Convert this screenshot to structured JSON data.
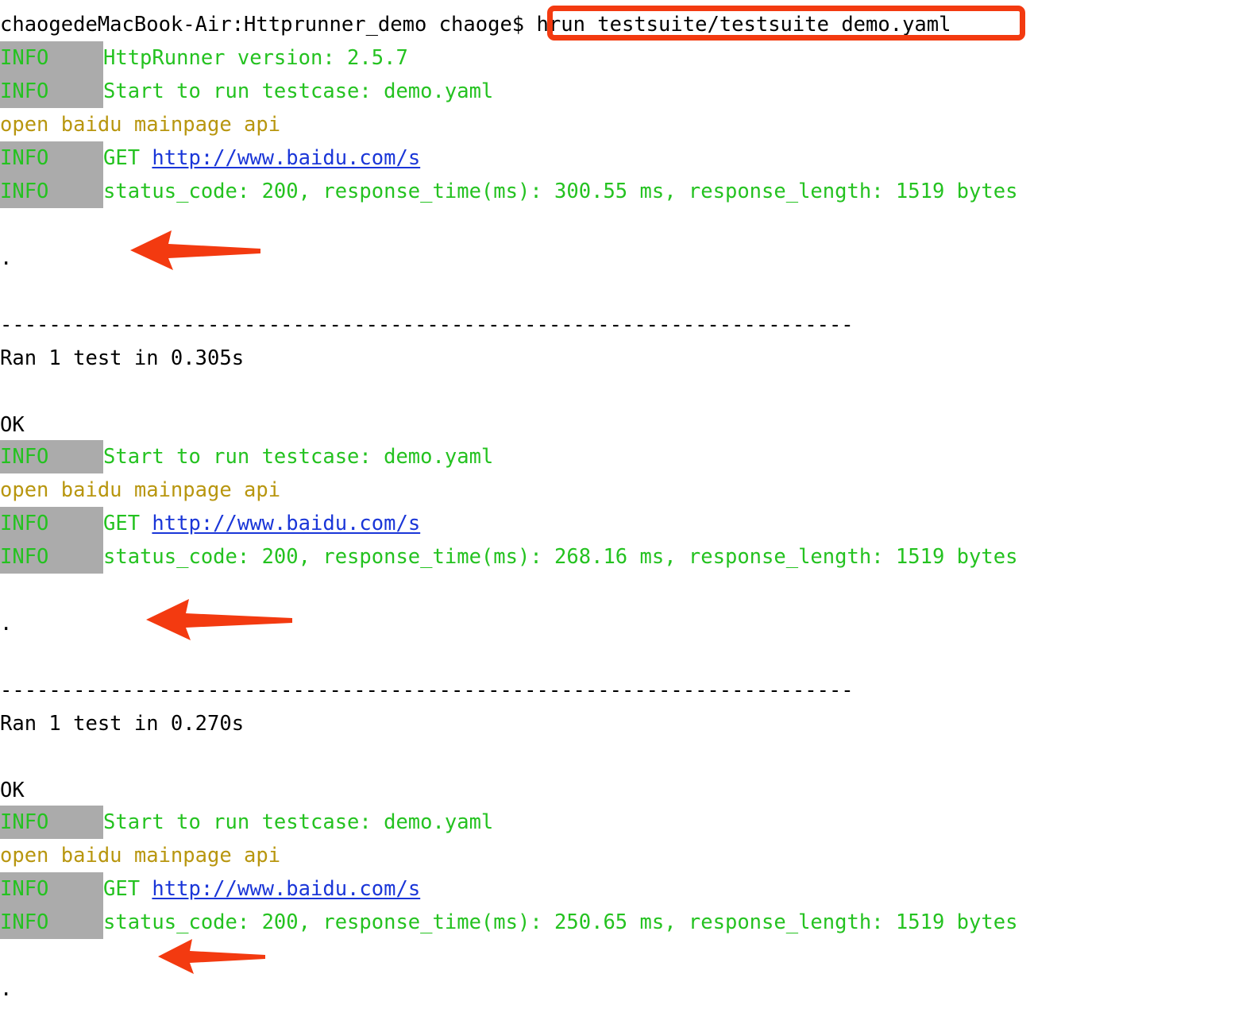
{
  "terminal": {
    "prompt": {
      "host_user": "chaogedeMacBook-Air:Httprunner_demo chaoge$",
      "command": "hrun testsuite/testsuite_demo.yaml"
    },
    "labels": {
      "info": "INFO",
      "ok": "OK",
      "dot": ".",
      "separator": "----------------------------------------------------------------------"
    },
    "blocks": [
      {
        "version_line": "HttpRunner version: 2.5.7",
        "start_line": "Start to run testcase: demo.yaml",
        "api_name": "open baidu mainpage api",
        "method": "GET ",
        "url": "http://www.baidu.com/s",
        "status_line": "status_code: 200, response_time(ms): 300.55 ms, response_length: 1519 bytes",
        "ran_line": "Ran 1 test in 0.305s",
        "result": "OK"
      },
      {
        "start_line": "Start to run testcase: demo.yaml",
        "api_name": "open baidu mainpage api",
        "method": "GET ",
        "url": "http://www.baidu.com/s",
        "status_line": "status_code: 200, response_time(ms): 268.16 ms, response_length: 1519 bytes",
        "ran_line": "Ran 1 test in 0.270s",
        "result": "OK"
      },
      {
        "start_line": "Start to run testcase: demo.yaml",
        "api_name": "open baidu mainpage api",
        "method": "GET ",
        "url": "http://www.baidu.com/s",
        "status_line": "status_code: 200, response_time(ms): 250.65 ms, response_length: 1519 bytes"
      }
    ],
    "annotations": {
      "highlight_color": "#f33a10",
      "arrow_color": "#f33a10",
      "arrow_count": 3,
      "box_target": "hrun testsuite/testsuite_demo.yaml"
    },
    "colors": {
      "info_text": "#24c220",
      "info_background": "#ababab",
      "message": "#24c220",
      "api_name": "#b8960f",
      "url": "#1a36d8",
      "plain": "#000000",
      "background": "#ffffff"
    },
    "top_clipped_text": "  "
  }
}
